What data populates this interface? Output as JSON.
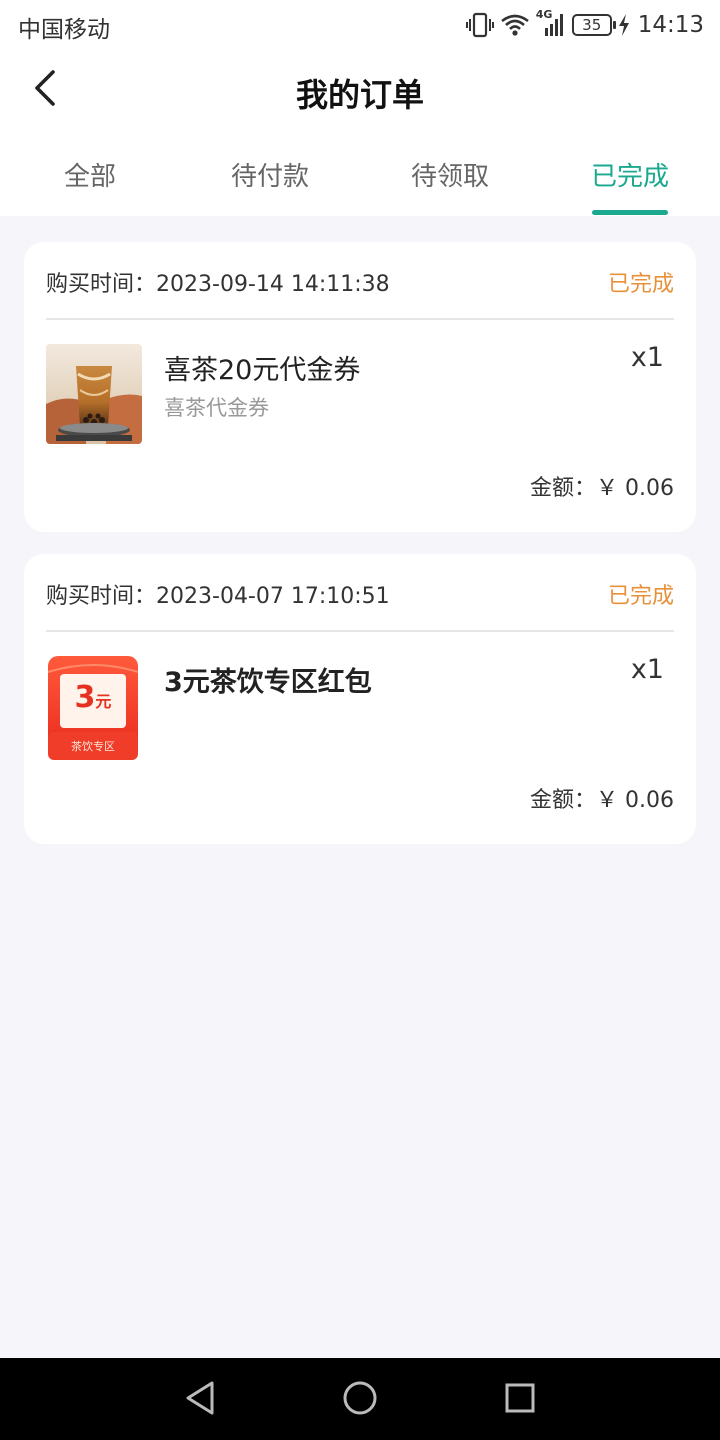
{
  "status_bar": {
    "carrier": "中国移动",
    "network": "4G",
    "battery": "35",
    "time": "14:13",
    "icons": [
      "vibrate-icon",
      "wifi-icon",
      "signal-icon",
      "charging-icon"
    ]
  },
  "header": {
    "title": "我的订单",
    "back_icon": "chevron-left-icon"
  },
  "tabs": [
    {
      "label": "全部",
      "active": false
    },
    {
      "label": "待付款",
      "active": false
    },
    {
      "label": "待领取",
      "active": false
    },
    {
      "label": "已完成",
      "active": true
    }
  ],
  "orders": [
    {
      "time_label": "购买时间：",
      "time": "2023-09-14 14:11:38",
      "status": "已完成",
      "item_name": "喜茶20元代金券",
      "item_sub": "喜茶代金券",
      "qty": "x1",
      "amount_label": "金额：",
      "amount": "￥ 0.06",
      "thumb": "milk-tea-photo"
    },
    {
      "time_label": "购买时间：",
      "time": "2023-04-07 17:10:51",
      "status": "已完成",
      "item_name": "3元茶饮专区红包",
      "item_sub": "",
      "qty": "x1",
      "amount_label": "金额：",
      "amount": "￥ 0.06",
      "thumb": "red-packet-image",
      "thumb_value": "3",
      "thumb_unit": "元",
      "thumb_caption": "茶饮专区"
    }
  ],
  "colors": {
    "accent": "#1aa98f",
    "status": "#e8913a",
    "page_bg": "#f5f5fa"
  },
  "system_nav": [
    "back-triangle-icon",
    "home-circle-icon",
    "recents-square-icon"
  ]
}
